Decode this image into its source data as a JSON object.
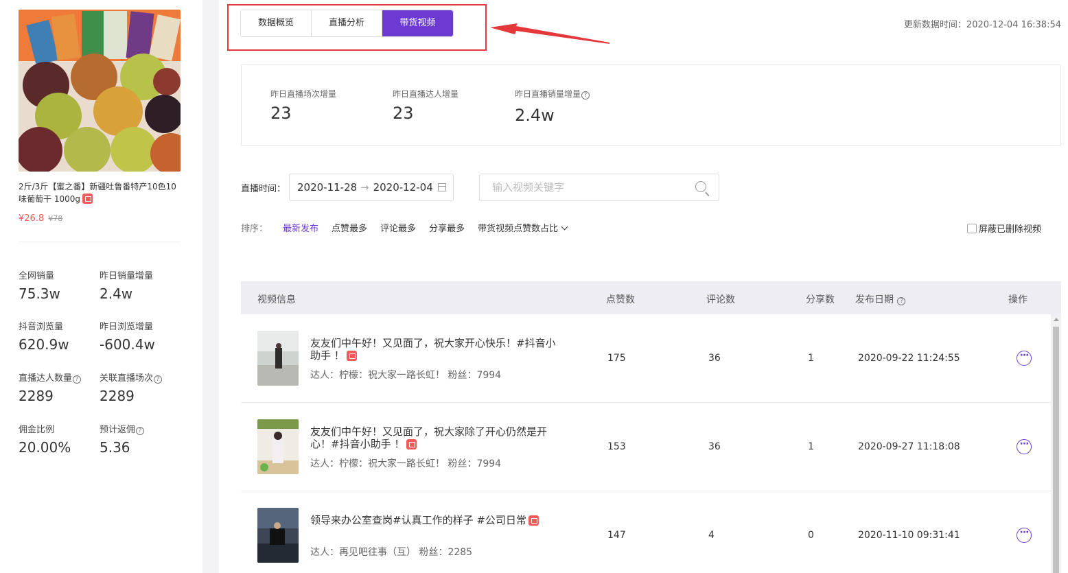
{
  "product": {
    "title": "2斤/3斤【蜜之番】新疆吐鲁番特产10色10味葡萄干 1000g",
    "price": "¥26.8",
    "original_price": "¥78"
  },
  "stats": [
    {
      "label": "全网销量",
      "value": "75.3w"
    },
    {
      "label": "昨日销量增量",
      "value": "2.4w"
    },
    {
      "label": "抖音浏览量",
      "value": "620.9w"
    },
    {
      "label": "昨日浏览增量",
      "value": "-600.4w"
    },
    {
      "label": "直播达人数量",
      "value": "2289"
    },
    {
      "label": "关联直播场次",
      "value": "2289"
    },
    {
      "label": "佣金比例",
      "value": "20.00%"
    },
    {
      "label": "预计返佣",
      "value": "5.36"
    }
  ],
  "tabs": [
    "数据概览",
    "直播分析",
    "带货视频"
  ],
  "update_time": "更新数据时间：2020-12-04 16:38:54",
  "summary": [
    {
      "label": "昨日直播场次增量",
      "value": "23"
    },
    {
      "label": "昨日直播达人增量",
      "value": "23"
    },
    {
      "label": "昨日直播销量增量",
      "value": "2.4w"
    }
  ],
  "filter": {
    "label": "直播时间：",
    "start_date": "2020-11-28",
    "end_date": "2020-12-04",
    "search_placeholder": "输入视频关键字"
  },
  "sort": {
    "label": "排序：",
    "options": [
      "最新发布",
      "点赞最多",
      "评论最多",
      "分享最多",
      "带货视频点赞数占比"
    ],
    "hide_deleted": "屏蔽已删除视频"
  },
  "table": {
    "headers": [
      "视频信息",
      "点赞数",
      "评论数",
      "分享数",
      "发布日期",
      "操作"
    ],
    "rows": [
      {
        "title": "友友们中午好！又见面了，祝大家开心快乐！#抖音小助手 ！",
        "author": "达人：柠檬：祝大家一路长虹！ 粉丝：7994",
        "likes": "175",
        "comments": "36",
        "shares": "1",
        "date": "2020-09-22 11:24:55"
      },
      {
        "title": "友友们中午好！又见面了，祝大家除了开心仍然是开心！#抖音小助手 ！",
        "author": "达人：柠檬：祝大家一路长虹！ 粉丝：7994",
        "likes": "153",
        "comments": "36",
        "shares": "1",
        "date": "2020-09-27 11:18:08"
      },
      {
        "title": "领导来办公室查岗#认真工作的样子 #公司日常",
        "author": "达人：再见吧往事（互） 粉丝：2285",
        "likes": "147",
        "comments": "4",
        "shares": "0",
        "date": "2020-11-10 09:31:41"
      }
    ]
  },
  "colors": {
    "accent": "#6c3ad1",
    "price": "#f25a5a",
    "highlight": "#e5383b"
  }
}
